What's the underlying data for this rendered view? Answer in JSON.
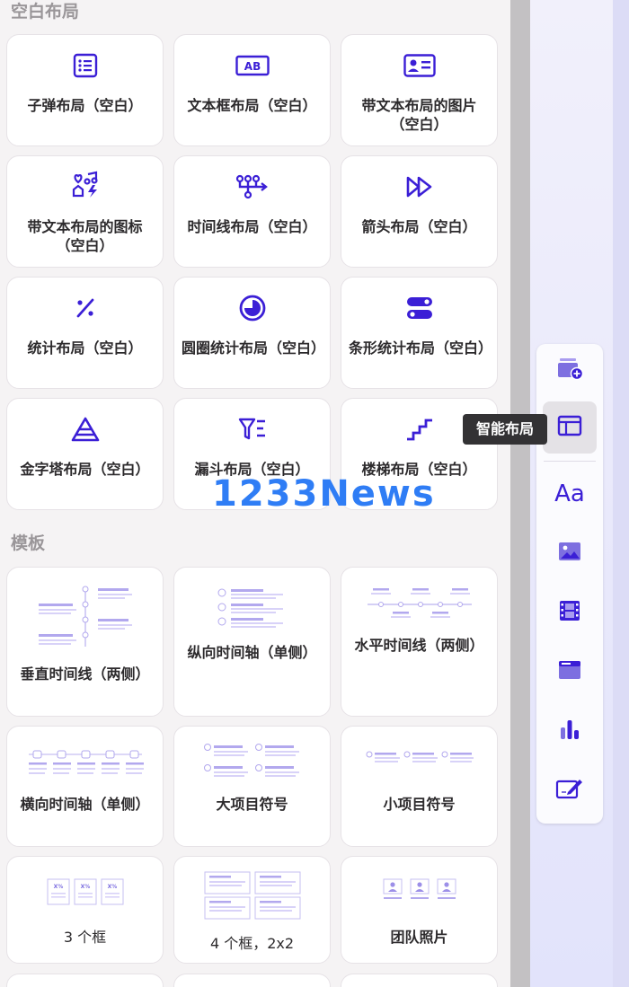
{
  "sections": {
    "blank_title": "空白布局",
    "template_title": "模板"
  },
  "blank_layouts": [
    {
      "label": "子弹布局（空白）",
      "icon": "bulleted-list-icon"
    },
    {
      "label": "文本框布局（空白）",
      "icon": "textbox-ab-icon"
    },
    {
      "label": "带文本布局的图片（空白）",
      "icon": "contact-card-icon"
    },
    {
      "label": "带文本布局的图标（空白）",
      "icon": "icons-shapes-icon"
    },
    {
      "label": "时间线布局（空白）",
      "icon": "timeline-branch-icon"
    },
    {
      "label": "箭头布局（空白）",
      "icon": "fast-forward-arrows-icon"
    },
    {
      "label": "统计布局（空白）",
      "icon": "percent-icon"
    },
    {
      "label": "圆圈统计布局（空白）",
      "icon": "pie-circle-icon"
    },
    {
      "label": "条形统计布局（空白）",
      "icon": "toggle-bars-icon"
    },
    {
      "label": "金字塔布局（空白）",
      "icon": "pyramid-icon"
    },
    {
      "label": "漏斗布局（空白）",
      "icon": "funnel-filter-icon"
    },
    {
      "label": "楼梯布局（空白）",
      "icon": "stairs-icon"
    }
  ],
  "templates": [
    {
      "label": "垂直时间线（两侧）"
    },
    {
      "label": "纵向时间轴（单侧）"
    },
    {
      "label": "水平时间线（两侧）"
    },
    {
      "label": "横向时间轴（单侧）"
    },
    {
      "label": "大项目符号"
    },
    {
      "label": "小项目符号"
    },
    {
      "label": "3 个框"
    },
    {
      "label": "4 个框，2x2"
    },
    {
      "label": "团队照片"
    }
  ],
  "toolbar": {
    "tooltip": "智能布局",
    "items": [
      {
        "icon": "add-layer-icon"
      },
      {
        "icon": "smart-layout-icon",
        "active": true
      },
      {
        "icon": "text-style-icon",
        "text": "Aa"
      },
      {
        "icon": "image-icon"
      },
      {
        "icon": "video-film-icon"
      },
      {
        "icon": "embed-card-icon"
      },
      {
        "icon": "bar-chart-icon"
      },
      {
        "icon": "edit-pen-icon"
      }
    ]
  },
  "watermark": "1233News",
  "colors": {
    "accent": "#3b1fd6",
    "light_accent": "#a99cf0",
    "tooltip_bg": "#333234"
  }
}
